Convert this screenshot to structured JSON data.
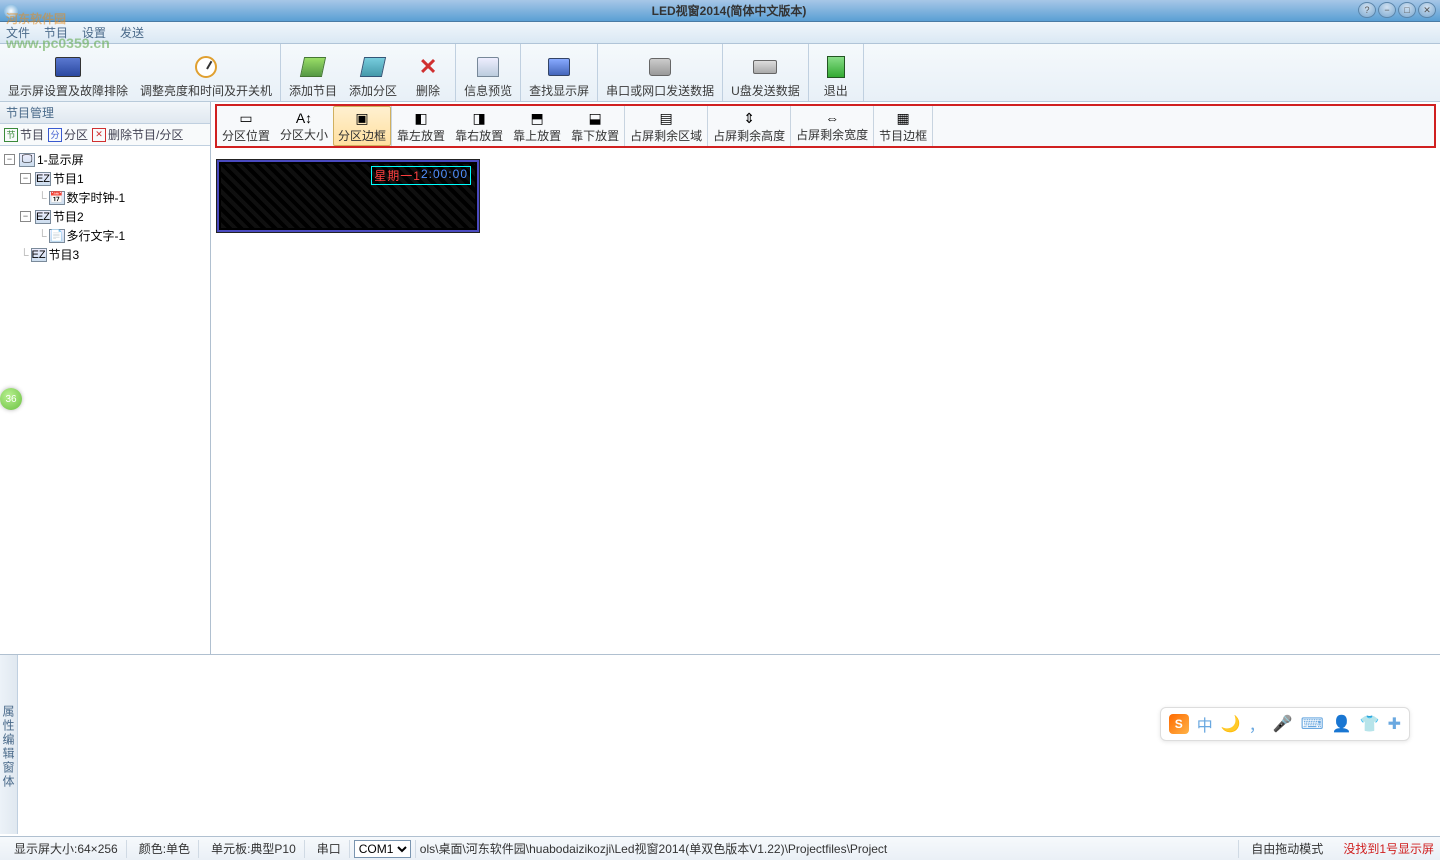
{
  "title": "LED视窗2014(简体中文版本)",
  "watermark": {
    "main": "河东软件园",
    "sub": "www.pc0359.cn"
  },
  "menubar": [
    "文件",
    "节目",
    "设置",
    "发送"
  ],
  "toolbar": [
    {
      "label": "显示屏设置及故障排除"
    },
    {
      "label": "调整亮度和时间及开关机"
    },
    {
      "label": "添加节目"
    },
    {
      "label": "添加分区"
    },
    {
      "label": "删除"
    },
    {
      "label": "信息预览"
    },
    {
      "label": "查找显示屏"
    },
    {
      "label": "串口或网口发送数据"
    },
    {
      "label": "U盘发送数据"
    },
    {
      "label": "退出"
    }
  ],
  "left_panel": {
    "header": "节目管理",
    "tree_toolbar": [
      {
        "label": "节目",
        "icon": "节",
        "color": "#3a8a3a"
      },
      {
        "label": "分区",
        "icon": "分",
        "color": "#3a5ad0"
      },
      {
        "label": "删除节目/分区",
        "icon": "✕",
        "color": "#d03030"
      }
    ],
    "tree": [
      {
        "indent": 0,
        "toggle": "−",
        "icon": "🖵",
        "label": "1-显示屏"
      },
      {
        "indent": 1,
        "toggle": "−",
        "icon": "EZ",
        "label": "节目1"
      },
      {
        "indent": 2,
        "toggle": "",
        "icon": "📅",
        "label": "数字时钟-1"
      },
      {
        "indent": 1,
        "toggle": "−",
        "icon": "EZ",
        "label": "节目2"
      },
      {
        "indent": 2,
        "toggle": "",
        "icon": "📄",
        "label": "多行文字-1"
      },
      {
        "indent": 1,
        "toggle": "",
        "icon": "EZ",
        "label": "节目3"
      }
    ]
  },
  "sec_toolbar": [
    {
      "label": "分区位置",
      "icon": "▭"
    },
    {
      "label": "分区大小",
      "icon": "A↕"
    },
    {
      "label": "分区边框",
      "icon": "▣",
      "hl": true
    },
    {
      "label": "靠左放置",
      "icon": "◧"
    },
    {
      "label": "靠右放置",
      "icon": "◨"
    },
    {
      "label": "靠上放置",
      "icon": "⬒"
    },
    {
      "label": "靠下放置",
      "icon": "⬓"
    },
    {
      "label": "占屏剩余区域",
      "icon": "▤"
    },
    {
      "label": "占屏剩余高度",
      "icon": "⇕"
    },
    {
      "label": "占屏剩余宽度",
      "icon": "⇔"
    },
    {
      "label": "节目边框",
      "icon": "▦"
    }
  ],
  "preview_clock": {
    "red": "星期一1",
    "blue": "2:00:00"
  },
  "props_panel_title": "属性编辑窗体",
  "ime": {
    "logo": "S",
    "lang": "中",
    "icons": [
      "🌙",
      "🎤",
      "⌨",
      "👤",
      "👕",
      "✚"
    ]
  },
  "statusbar": {
    "size_label": "显示屏大小:64×256",
    "color_label": "颜色:单色",
    "board_label": "单元板:典型P10",
    "port_label": "串口",
    "com": "COM1",
    "path": "ols\\桌面\\河东软件园\\huabodaizikozji\\Led视窗2014(单双色版本V1.22)\\Projectfiles\\Project",
    "mode": "自由拖动模式",
    "error": "没找到1号显示屏"
  },
  "side_badge": "36"
}
